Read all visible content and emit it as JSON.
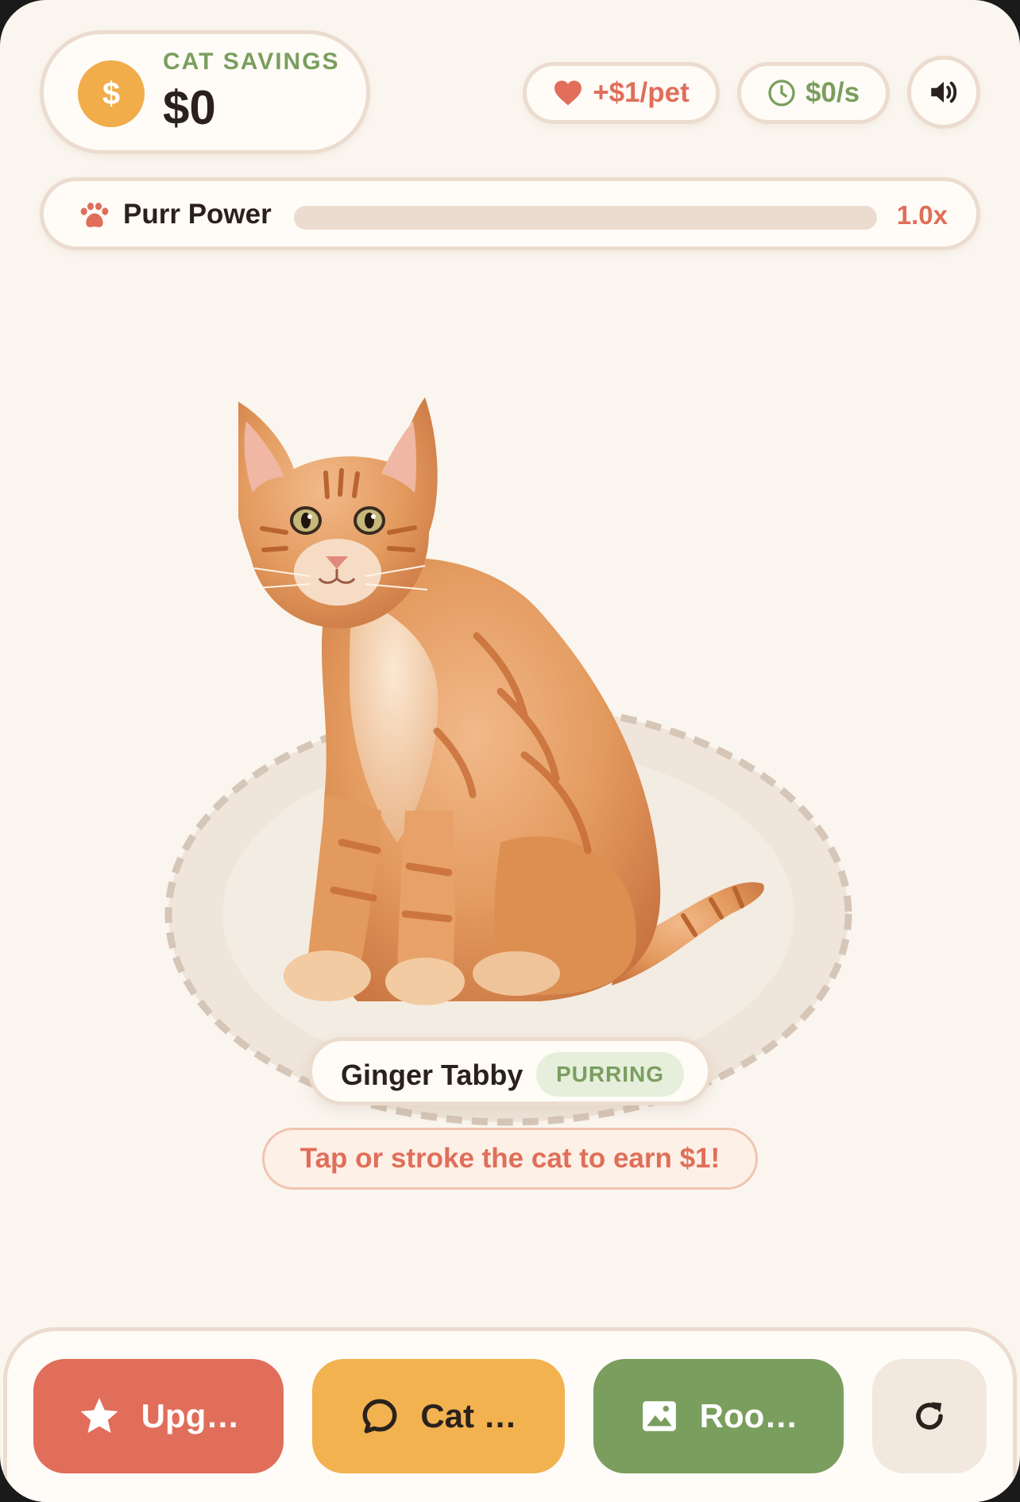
{
  "wallet": {
    "coin_symbol": "$",
    "label": "CAT SAVINGS",
    "amount": "$0"
  },
  "stats": {
    "per_pet": "+$1/pet",
    "per_second": "$0/s"
  },
  "sound": {
    "icon": "speaker-icon"
  },
  "purr_power": {
    "label": "Purr Power",
    "multiplier": "1.0x",
    "progress_fraction": 0
  },
  "cat": {
    "name": "Ginger Tabby",
    "status": "PURRING"
  },
  "hint": "Tap or stroke the cat to earn $1!",
  "bottom_nav": {
    "upgrades_label": "Upg…",
    "cats_label": "Cat …",
    "rooms_label": "Roo…",
    "reset_icon": "refresh-icon"
  },
  "colors": {
    "background": "#faf6ef",
    "accent_red": "#e06e5a",
    "accent_yellow": "#f2b24f",
    "accent_green": "#7a9e5e",
    "coin": "#f0ad4a",
    "border": "#ecdcd0"
  }
}
